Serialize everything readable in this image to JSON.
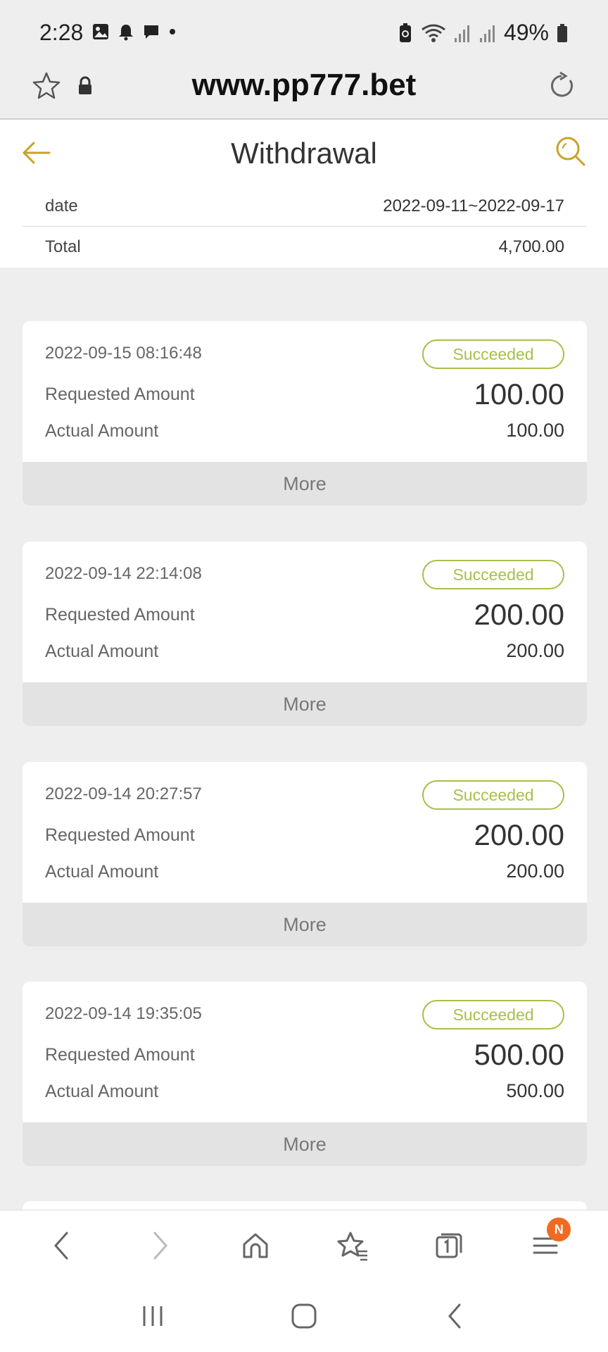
{
  "status_bar": {
    "time": "2:28",
    "battery": "49%",
    "icons_left": [
      "image-icon",
      "bell-icon",
      "message-icon",
      "dot-icon"
    ],
    "icons_right": [
      "battery-saver-icon",
      "wifi-icon",
      "signal-icon",
      "signal-icon",
      "battery-icon"
    ]
  },
  "browser": {
    "url": "www.pp777.bet"
  },
  "header": {
    "title": "Withdrawal",
    "date_label": "date",
    "date_value": "2022-09-11~2022-09-17",
    "total_label": "Total",
    "total_value": "4,700.00"
  },
  "records": [
    {
      "time": "2022-09-15 08:16:48",
      "status": "Succeeded",
      "requested_label": "Requested Amount",
      "requested": "100.00",
      "actual_label": "Actual Amount",
      "actual": "100.00",
      "more": "More"
    },
    {
      "time": "2022-09-14 22:14:08",
      "status": "Succeeded",
      "requested_label": "Requested Amount",
      "requested": "200.00",
      "actual_label": "Actual Amount",
      "actual": "200.00",
      "more": "More"
    },
    {
      "time": "2022-09-14 20:27:57",
      "status": "Succeeded",
      "requested_label": "Requested Amount",
      "requested": "200.00",
      "actual_label": "Actual Amount",
      "actual": "200.00",
      "more": "More"
    },
    {
      "time": "2022-09-14 19:35:05",
      "status": "Succeeded",
      "requested_label": "Requested Amount",
      "requested": "500.00",
      "actual_label": "Actual Amount",
      "actual": "500.00",
      "more": "More"
    }
  ],
  "toolbar": {
    "menu_badge": "N"
  },
  "colors": {
    "accent": "#c9a227",
    "success": "#a7c04a",
    "notification": "#f06a22"
  }
}
